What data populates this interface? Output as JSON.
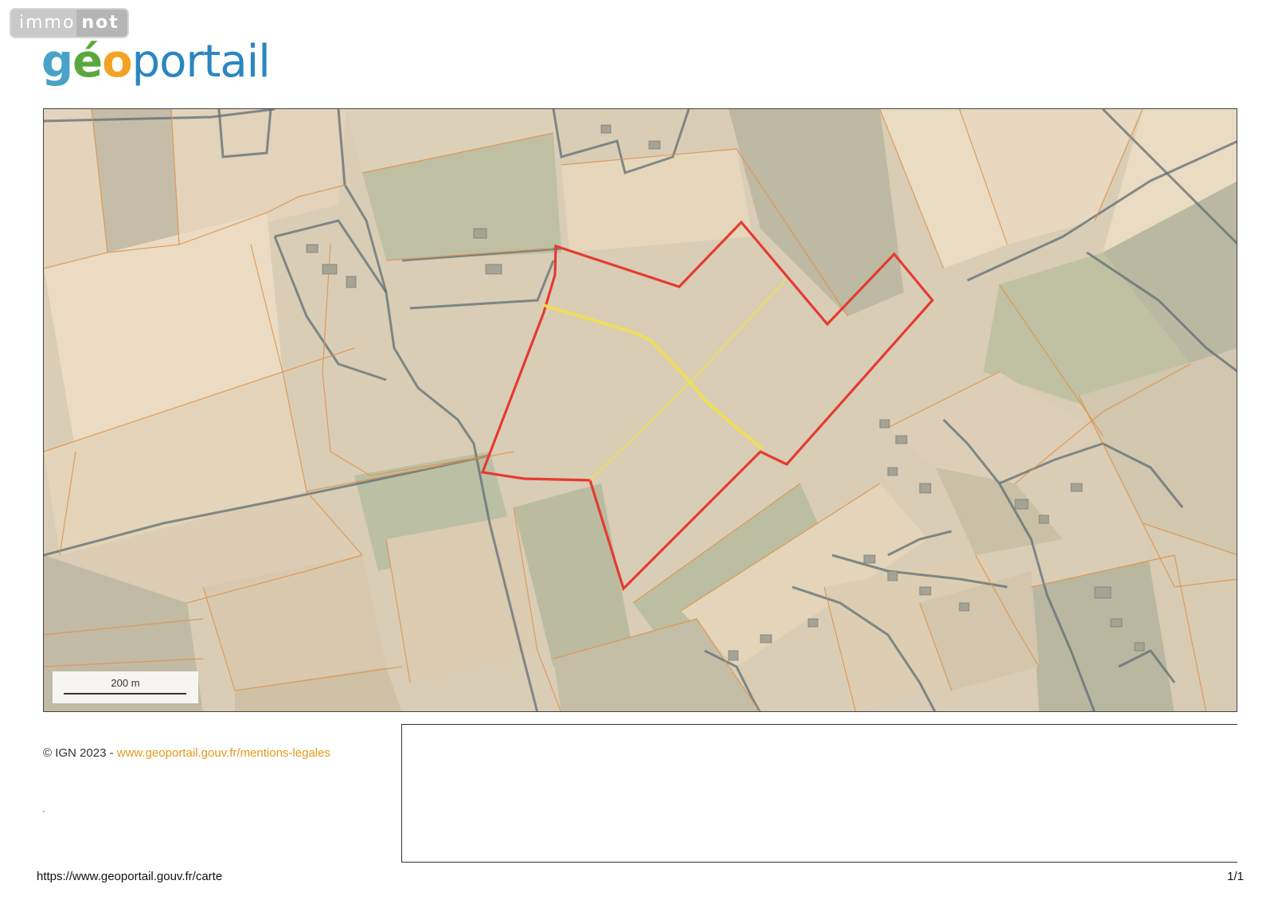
{
  "watermark": {
    "part1": "immo",
    "part2": "not"
  },
  "logo": {
    "g": "g",
    "e": "é",
    "o": "o",
    "rest": "portail"
  },
  "map": {
    "scale_label": "200 m",
    "colors": {
      "parcel_outline": "#e0904a",
      "selection_outline": "#e53b32",
      "inner_line": "#f2e04c",
      "boundary": "#5f6e74"
    }
  },
  "copyright": {
    "text": "© IGN 2023 - ",
    "link": "www.geoportail.gouv.fr/mentions-legales"
  },
  "footer": {
    "url": "https://www.geoportail.gouv.fr/carte",
    "page": "1/1"
  }
}
